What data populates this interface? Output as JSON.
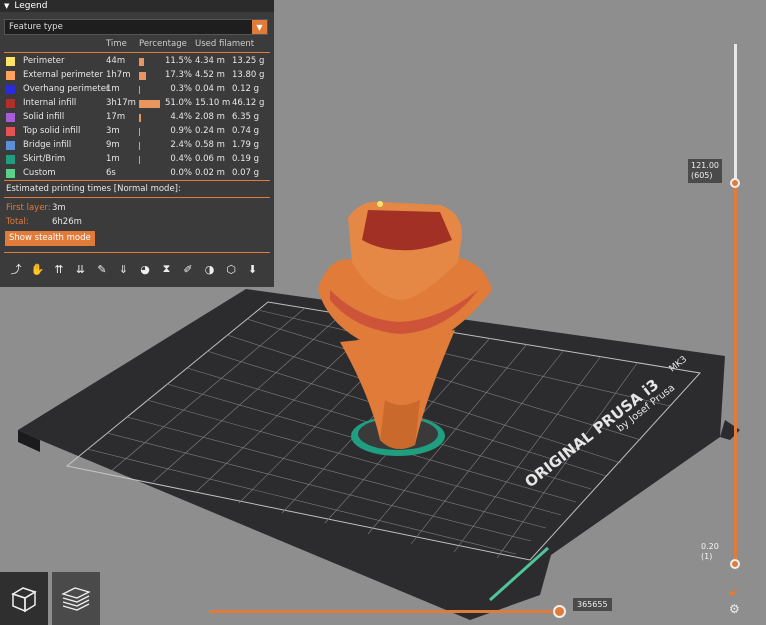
{
  "legend": {
    "title": "Legend",
    "view_type": "Feature type",
    "columns": {
      "time": "Time",
      "percentage": "Percentage",
      "filament": "Used filament"
    },
    "features": [
      {
        "name": "Perimeter",
        "time": "44m",
        "pct": "11.5%",
        "pct_value": 11.5,
        "length": "4.34 m",
        "weight": "13.25 g",
        "color": "#ffe468"
      },
      {
        "name": "External perimeter",
        "time": "1h7m",
        "pct": "17.3%",
        "pct_value": 17.3,
        "length": "4.52 m",
        "weight": "13.80 g",
        "color": "#ffa25e"
      },
      {
        "name": "Overhang perimeter",
        "time": "1m",
        "pct": "0.3%",
        "pct_value": 0.3,
        "length": "0.04 m",
        "weight": "0.12 g",
        "color": "#2a2adf"
      },
      {
        "name": "Internal infill",
        "time": "3h17m",
        "pct": "51.0%",
        "pct_value": 51.0,
        "length": "15.10 m",
        "weight": "46.12 g",
        "color": "#b03029"
      },
      {
        "name": "Solid infill",
        "time": "17m",
        "pct": "4.4%",
        "pct_value": 4.4,
        "length": "2.08 m",
        "weight": "6.35 g",
        "color": "#a65ed6"
      },
      {
        "name": "Top solid infill",
        "time": "3m",
        "pct": "0.9%",
        "pct_value": 0.9,
        "length": "0.24 m",
        "weight": "0.74 g",
        "color": "#e95252"
      },
      {
        "name": "Bridge infill",
        "time": "9m",
        "pct": "2.4%",
        "pct_value": 2.4,
        "length": "0.58 m",
        "weight": "1.79 g",
        "color": "#5c8ed9"
      },
      {
        "name": "Skirt/Brim",
        "time": "1m",
        "pct": "0.4%",
        "pct_value": 0.4,
        "length": "0.06 m",
        "weight": "0.19 g",
        "color": "#1f9e80"
      },
      {
        "name": "Custom",
        "time": "6s",
        "pct": "0.0%",
        "pct_value": 0.0,
        "length": "0.02 m",
        "weight": "0.07 g",
        "color": "#5cd08a"
      }
    ],
    "estimated_label": "Estimated printing times [Normal mode]:",
    "first_layer_label": "First layer:",
    "first_layer_value": "3m",
    "total_label": "Total:",
    "total_value": "6h26m",
    "stealth_button": "Show stealth mode",
    "toolbar_icons": [
      "travel-icon",
      "wipe-icon",
      "retractions-icon",
      "deretractions-icon",
      "seams-icon",
      "tool-changes-icon",
      "color-changes-icon",
      "pause-icon",
      "custom-gcode-icon",
      "center-of-gravity-icon",
      "shells-icon",
      "tool-marker-icon"
    ]
  },
  "vertical_slider": {
    "top_label_line1": "121.00",
    "top_label_line2": "(605)",
    "bottom_label_line1": "0.20",
    "bottom_label_line2": "(1)"
  },
  "horizontal_slider": {
    "label": "365655"
  },
  "bed": {
    "text_line1": "ORIGINAL PRUSA i3",
    "text_mk3": "MK3",
    "text_line2": "by Josef Prusa"
  },
  "colors": {
    "accent": "#e07b39",
    "background": "#8c8c8c",
    "panel": "#363636"
  }
}
